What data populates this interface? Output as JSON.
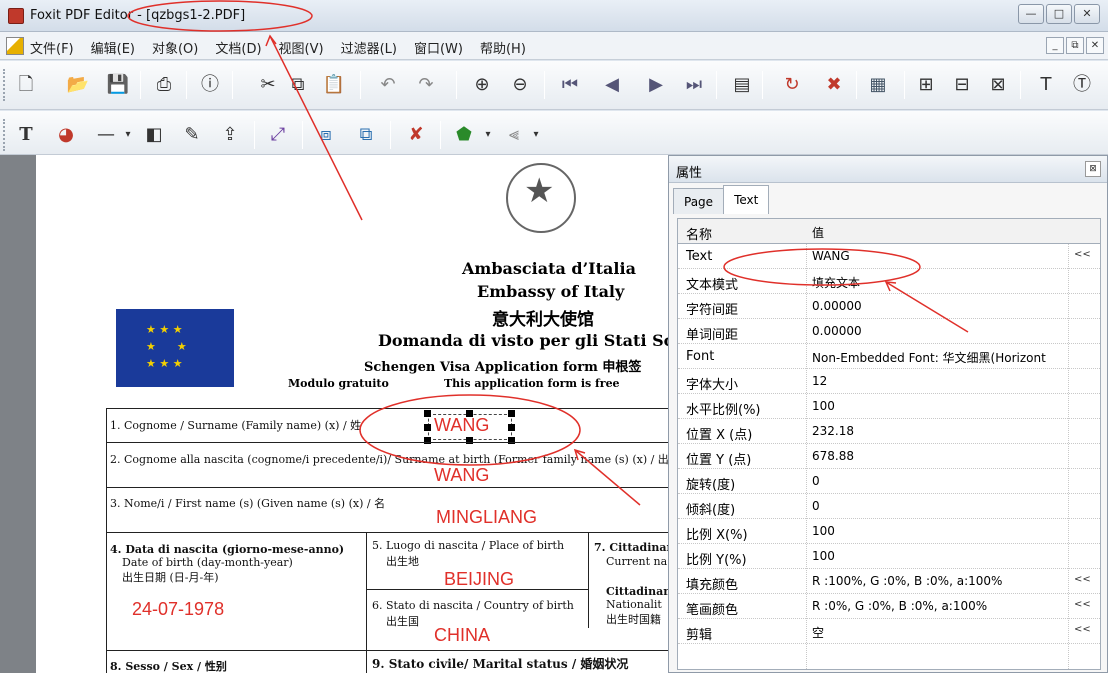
{
  "window": {
    "title": "Foxit PDF Editor - [qzbgs1-2.PDF]",
    "minimize": "—",
    "maximize": "□",
    "close": "✕"
  },
  "menubar": {
    "items": [
      "文件(F)",
      "编辑(E)",
      "对象(O)",
      "文档(D)",
      "视图(V)",
      "过滤器(L)",
      "窗口(W)",
      "帮助(H)"
    ],
    "mdi": [
      "_",
      "⧉",
      "✕"
    ]
  },
  "toolbar1": {
    "icons": [
      "new-icon",
      "open-icon",
      "save-icon",
      "print-icon",
      "info-icon",
      "cut-icon",
      "copy-icon",
      "paste-icon",
      "undo-icon",
      "redo-icon",
      "zoom-in-icon",
      "zoom-out-icon",
      "first-page-icon",
      "prev-page-icon",
      "next-page-icon",
      "last-page-icon",
      "page-icon",
      "rotate-icon",
      "delete-icon",
      "grid-icon",
      "text-fit-icon",
      "align-icon",
      "distribute-icon",
      "text-tool-icon",
      "info-circle-icon"
    ]
  },
  "toolbar2": {
    "icons": [
      "text-object-icon",
      "color-icon",
      "line-icon",
      "image-icon",
      "edit-icon",
      "export-icon",
      "transform-icon",
      "group-icon",
      "ungroup-icon",
      "cancel-icon",
      "shape-icon",
      "align-left-icon"
    ]
  },
  "document": {
    "embassy_it": "Ambasciata d’Italia",
    "embassy_en": "Embassy of Italy",
    "embassy_cn": "意大利大使馆",
    "form_title": "Domanda di visto per gli Stati Sc",
    "form_subtitle": "Schengen Visa Application form   申根签",
    "free_it": "Modulo gratuito",
    "free_en": "This application form is free",
    "f1": "1. Cognome /  Surname (Family name) (x) /  姓",
    "v1": "WANG",
    "f2": "2. Cognome alla nascita (cognome/i precedente/i)/  Surname at birth (Former family name (s) (x) /  出",
    "v2": "WANG",
    "f3": "3. Nome/i  / First name (s) (Given name (s) (x) /  名",
    "v3": "MINGLIANG",
    "f4a": "4. Data di nascita (giorno-mese-anno)",
    "f4b": "Date of birth (day-month-year)",
    "f4c": "出生日期 (日-月-年)",
    "v4": "24-07-1978",
    "f5a": "5. Luogo di nascita / Place of birth",
    "f5b": "出生地",
    "v5": "BEIJING",
    "f6a": "6. Stato di nascita / Country of birth",
    "f6b": "出生国",
    "v6": "CHINA",
    "f7a": "7. Cittadinan",
    "f7b": "Current na",
    "f7c": "Cittadinan",
    "f7d": "Nationalit",
    "f7e": "出生时国籍",
    "f8": "8. Sesso / Sex  /  性别",
    "f9": "9. Stato civile/ Marital status  /  婚姻状况"
  },
  "properties": {
    "title": "属性",
    "close": "⊠",
    "tabs": [
      "Page",
      "Text"
    ],
    "header": [
      "名称",
      "值"
    ],
    "rows": [
      {
        "name": "Text",
        "value": "WANG",
        "more": "<<"
      },
      {
        "name": "文本模式",
        "value": "填充文本",
        "more": ""
      },
      {
        "name": "字符间距",
        "value": "0.00000",
        "more": ""
      },
      {
        "name": "单词间距",
        "value": "0.00000",
        "more": ""
      },
      {
        "name": "Font",
        "value": "Non-Embedded Font: 华文细黑(Horizont",
        "more": ""
      },
      {
        "name": "字体大小",
        "value": "12",
        "more": ""
      },
      {
        "name": "水平比例(%)",
        "value": "100",
        "more": ""
      },
      {
        "name": "位置 X (点)",
        "value": "232.18",
        "more": ""
      },
      {
        "name": "位置 Y (点)",
        "value": "678.88",
        "more": ""
      },
      {
        "name": "旋转(度)",
        "value": "0",
        "more": ""
      },
      {
        "name": "倾斜(度)",
        "value": "0",
        "more": ""
      },
      {
        "name": "比例 X(%)",
        "value": "100",
        "more": ""
      },
      {
        "name": "比例 Y(%)",
        "value": "100",
        "more": ""
      },
      {
        "name": "填充颜色",
        "value": "R :100%, G :0%, B :0%, a:100%",
        "more": "<<"
      },
      {
        "name": "笔画颜色",
        "value": "R :0%, G :0%, B :0%, a:100%",
        "more": "<<"
      },
      {
        "name": "剪辑",
        "value": "空",
        "more": "<<"
      }
    ]
  },
  "colors": {
    "annotation": "#e0302a",
    "accent": "#1a3a9a"
  }
}
